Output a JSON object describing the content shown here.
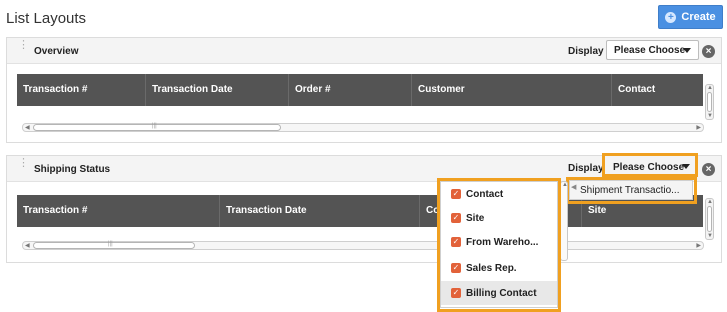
{
  "page": {
    "title": "List Layouts"
  },
  "toolbar": {
    "create_label": "Create"
  },
  "panels": [
    {
      "title": "Overview",
      "display_label": "Display",
      "display_value": "Please Choose",
      "columns": [
        "Transaction #",
        "Transaction Date",
        "Order #",
        "Customer",
        "Contact"
      ]
    },
    {
      "title": "Shipping Status",
      "display_label": "Display",
      "display_value": "Please Choose",
      "columns": [
        "Transaction #",
        "Transaction Date",
        "Co",
        "Site"
      ],
      "display_options": [
        "Shipment Transactio..."
      ],
      "column_chooser": [
        {
          "label": "Contact",
          "checked": true
        },
        {
          "label": "Site",
          "checked": true
        },
        {
          "label": "From Wareho...",
          "checked": true
        },
        {
          "label": "Sales Rep.",
          "checked": true
        },
        {
          "label": "Billing Contact",
          "checked": true,
          "highlighted": true
        }
      ]
    }
  ],
  "colors": {
    "accent": "#4a90e2",
    "highlight": "#f0a020",
    "checkbox": "#e2623a",
    "grid_header": "#545454"
  },
  "icons": {
    "grip": "drag-handle-icon",
    "close": "close-icon",
    "caret": "chevron-down-icon",
    "check": "checkbox-checked-icon"
  }
}
